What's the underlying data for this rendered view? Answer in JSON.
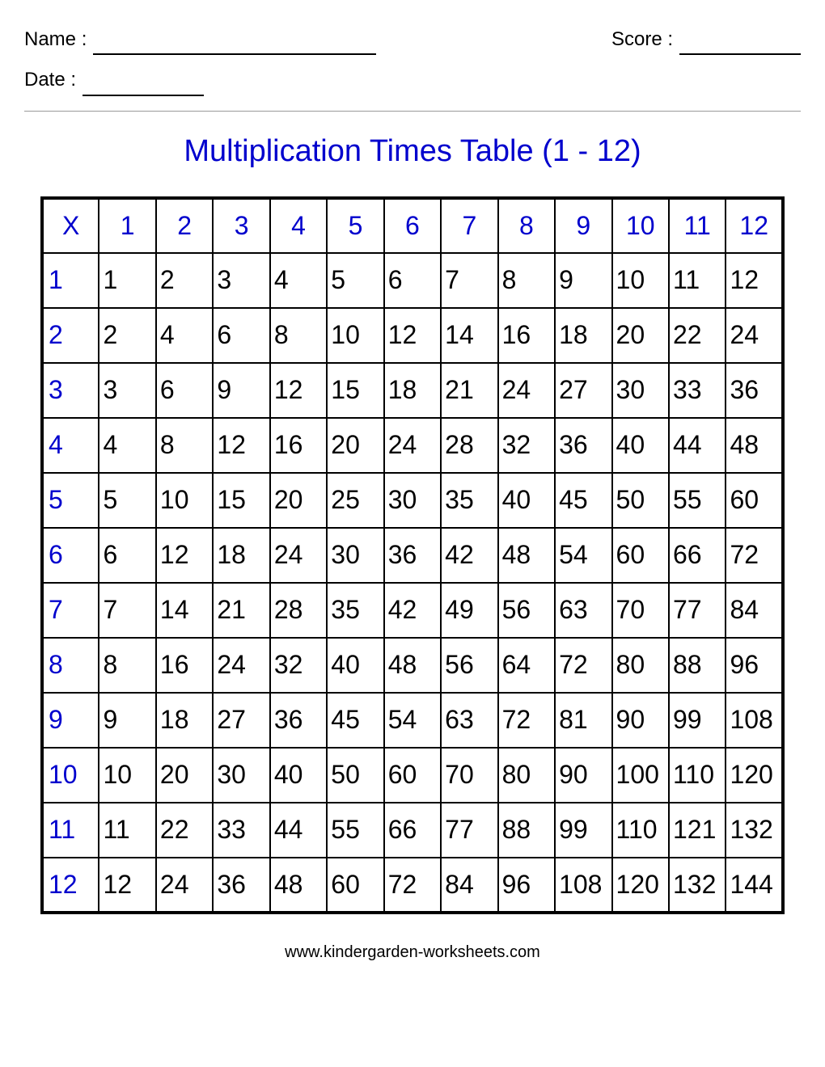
{
  "header": {
    "name_label": "Name :",
    "score_label": "Score :",
    "date_label": "Date :"
  },
  "title": "Multiplication Times Table  (1 - 12)",
  "chart_data": {
    "type": "table",
    "title": "Multiplication Times Table (1 - 12)",
    "corner": "X",
    "col_headers": [
      1,
      2,
      3,
      4,
      5,
      6,
      7,
      8,
      9,
      10,
      11,
      12
    ],
    "row_headers": [
      1,
      2,
      3,
      4,
      5,
      6,
      7,
      8,
      9,
      10,
      11,
      12
    ],
    "values": [
      [
        1,
        2,
        3,
        4,
        5,
        6,
        7,
        8,
        9,
        10,
        11,
        12
      ],
      [
        2,
        4,
        6,
        8,
        10,
        12,
        14,
        16,
        18,
        20,
        22,
        24
      ],
      [
        3,
        6,
        9,
        12,
        15,
        18,
        21,
        24,
        27,
        30,
        33,
        36
      ],
      [
        4,
        8,
        12,
        16,
        20,
        24,
        28,
        32,
        36,
        40,
        44,
        48
      ],
      [
        5,
        10,
        15,
        20,
        25,
        30,
        35,
        40,
        45,
        50,
        55,
        60
      ],
      [
        6,
        12,
        18,
        24,
        30,
        36,
        42,
        48,
        54,
        60,
        66,
        72
      ],
      [
        7,
        14,
        21,
        28,
        35,
        42,
        49,
        56,
        63,
        70,
        77,
        84
      ],
      [
        8,
        16,
        24,
        32,
        40,
        48,
        56,
        64,
        72,
        80,
        88,
        96
      ],
      [
        9,
        18,
        27,
        36,
        45,
        54,
        63,
        72,
        81,
        90,
        99,
        108
      ],
      [
        10,
        20,
        30,
        40,
        50,
        60,
        70,
        80,
        90,
        100,
        110,
        120
      ],
      [
        11,
        22,
        33,
        44,
        55,
        66,
        77,
        88,
        99,
        110,
        121,
        132
      ],
      [
        12,
        24,
        36,
        48,
        60,
        72,
        84,
        96,
        108,
        120,
        132,
        144
      ]
    ]
  },
  "footer": "www.kindergarden-worksheets.com"
}
